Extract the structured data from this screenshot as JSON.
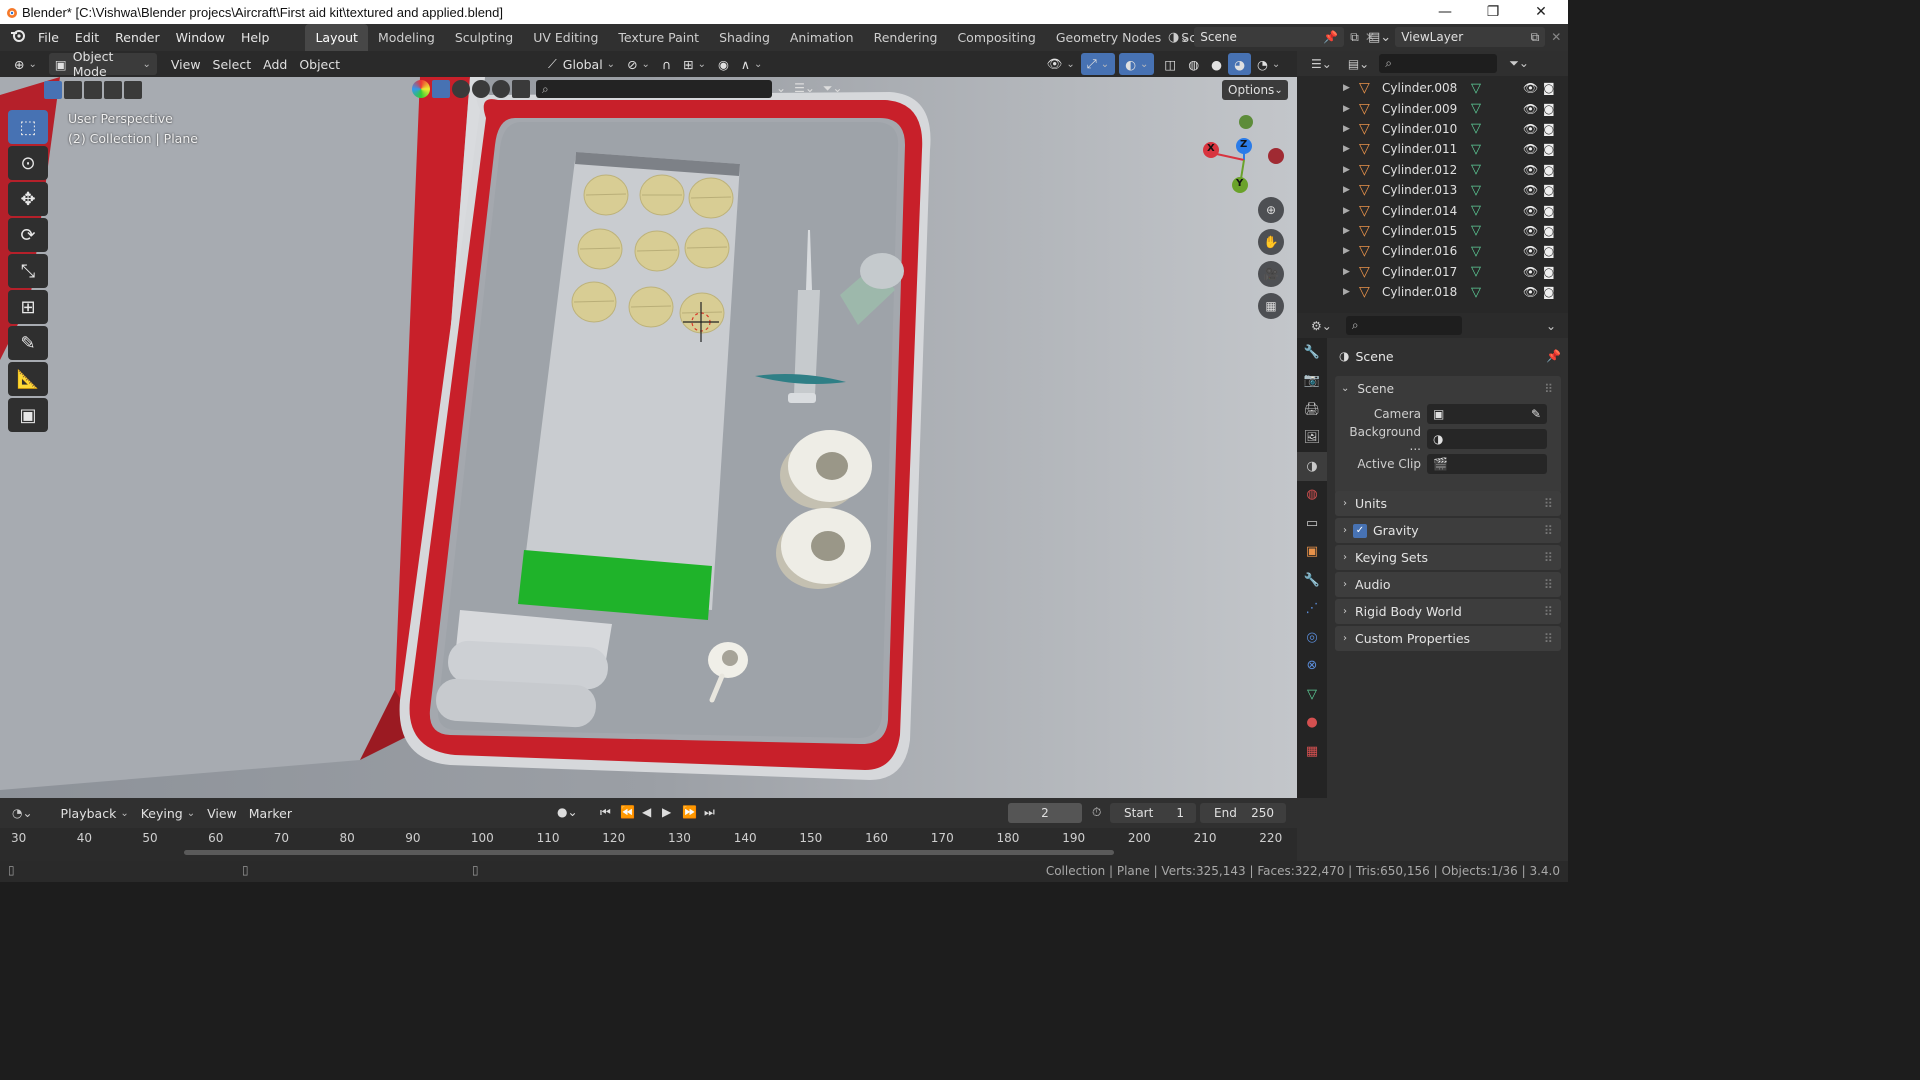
{
  "window": {
    "title": "Blender* [C:\\Vishwa\\Blender projecs\\Aircraft\\First aid kit\\textured and applied.blend]",
    "minimize_glyph": "—",
    "maximize_glyph": "❐",
    "close_glyph": "✕"
  },
  "menu": [
    "File",
    "Edit",
    "Render",
    "Window",
    "Help"
  ],
  "workspaces": [
    "Layout",
    "Modeling",
    "Sculpting",
    "UV Editing",
    "Texture Paint",
    "Shading",
    "Animation",
    "Rendering",
    "Compositing",
    "Geometry Nodes",
    "Scripting"
  ],
  "active_workspace": "Layout",
  "scene_field": "Scene",
  "viewlayer_field": "ViewLayer",
  "viewport_header": {
    "mode": "Object Mode",
    "menus": [
      "View",
      "Select",
      "Add",
      "Object"
    ],
    "transform": "Global",
    "options": "Options"
  },
  "viewport": {
    "perspective": "User Perspective",
    "collection_info": "(2) Collection | Plane",
    "gizmo": {
      "x": "X",
      "y": "Y",
      "z": "Z"
    }
  },
  "outliner": {
    "items": [
      "Cylinder.008",
      "Cylinder.009",
      "Cylinder.010",
      "Cylinder.011",
      "Cylinder.012",
      "Cylinder.013",
      "Cylinder.014",
      "Cylinder.015",
      "Cylinder.016",
      "Cylinder.017",
      "Cylinder.018"
    ]
  },
  "properties": {
    "header": "Scene",
    "section": "Scene",
    "camera_label": "Camera",
    "background_label": "Background ...",
    "active_clip_label": "Active Clip",
    "panels": [
      "Units",
      "Gravity",
      "Keying Sets",
      "Audio",
      "Rigid Body World",
      "Custom Properties"
    ],
    "gravity_checked": true
  },
  "timeline": {
    "menus": [
      "Playback",
      "Keying",
      "View",
      "Marker"
    ],
    "current_frame": "2",
    "start_label": "Start",
    "start_value": "1",
    "end_label": "End",
    "end_value": "250",
    "ruler": [
      "30",
      "40",
      "50",
      "60",
      "70",
      "80",
      "90",
      "100",
      "110",
      "120",
      "130",
      "140",
      "150",
      "160",
      "170",
      "180",
      "190",
      "200",
      "210",
      "220"
    ]
  },
  "status": "Collection | Plane | Verts:325,143 | Faces:322,470 | Tris:650,156 | Objects:1/36 | 3.4.0",
  "colors": {
    "accent": "#4772b3",
    "kit_red": "#c8202a",
    "green_label": "#1fb32a",
    "pill": "#d8cd94"
  }
}
